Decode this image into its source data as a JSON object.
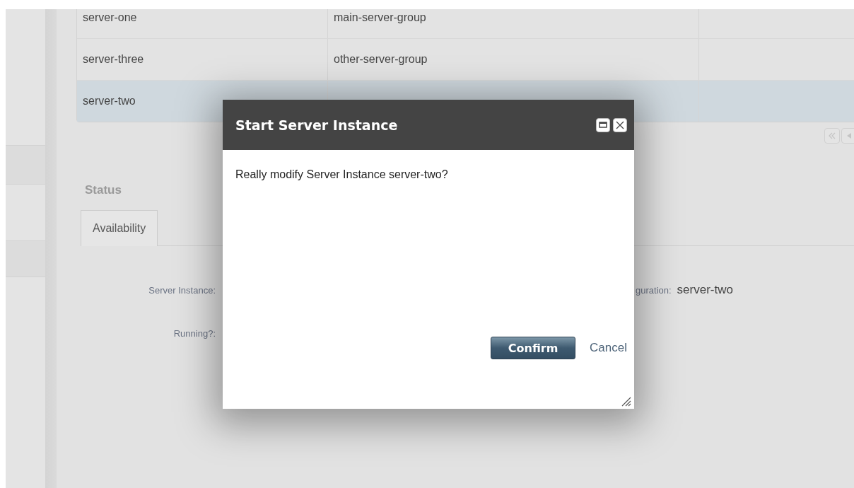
{
  "table": {
    "rows": [
      {
        "cells": [
          "server-one",
          "main-server-group"
        ],
        "selected": false
      },
      {
        "cells": [
          "server-three",
          "other-server-group"
        ],
        "selected": false
      },
      {
        "cells": [
          "server-two"
        ],
        "selected": true
      }
    ]
  },
  "status": {
    "heading": "Status",
    "tabs": [
      {
        "label": "Availability",
        "selected": true
      }
    ],
    "fields": [
      {
        "label": "Server Instance:"
      },
      {
        "label": "Running?:"
      }
    ],
    "side_field": {
      "label": "guration:",
      "value": "server-two"
    }
  },
  "dialog": {
    "title": "Start Server Instance",
    "message": "Really modify Server Instance server-two?",
    "confirm": "Confirm",
    "cancel": "Cancel"
  }
}
